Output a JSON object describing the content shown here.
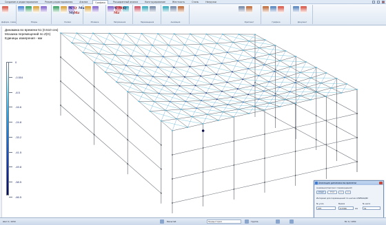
{
  "titlebar": {
    "tabs": [
      "Создание и редактирование",
      "Режим редактирования",
      "Анализ",
      "Графика",
      "Расширенный анализ",
      "Конструирование",
      "Жесткость",
      "Сталь",
      "Нагрузки"
    ],
    "active_tab": 3
  },
  "ribbon": {
    "groups": [
      {
        "label": "Деформ. схема"
      },
      {
        "label": "Эпюры"
      },
      {
        "label": "Усилия"
      },
      {
        "label": "Мозаика"
      },
      {
        "label": "Напряжения"
      },
      {
        "label": "Перемещения"
      },
      {
        "label": "Анимация"
      },
      {
        "label": "Фрагмент"
      },
      {
        "label": "Графика"
      },
      {
        "label": "Документ"
      }
    ],
    "icons": {
      "group1": [
        "N",
        "M",
        "Q",
        "Σ"
      ],
      "group2": [
        "N",
        "Q",
        "Mx",
        "My",
        "Mz"
      ],
      "group3": [
        "N",
        "My",
        "Q",
        "Mz"
      ]
    }
  },
  "info": {
    "line1": "Динамика во времени 51 (0.510 сек)",
    "line2": "Мозаика перемещений по Z(G)",
    "line3": "Единицы измерения - мм"
  },
  "legend": {
    "ticks": [
      "0",
      "-0.504",
      "-8.5",
      "-16.6",
      "-24.8",
      "-33.2",
      "-41.5",
      "-49.8",
      "-58.5",
      "-66.5"
    ]
  },
  "dialog": {
    "title": "Анимация динамики во времени",
    "animation_label": "Анимация(прогресс перемещений)",
    "start_label": "Старт",
    "stop_label": "Стоп",
    "prev_label": "<<",
    "next_label": ">>",
    "interval_label": "Интервал для перемещений по шагам АНИМАЦИИ",
    "col1_label": "№ узла",
    "col2_label": "Время",
    "col3_label": "№ шага",
    "col1_value": "375",
    "col2_value": "0.5780",
    "col2_unit": "мм",
    "col3_value": "51"
  },
  "statusbar": {
    "left_text": "Шаг 0 / 1050",
    "scale_text": "Масштаб",
    "mode_value": "Предыстория",
    "group_text": "Группа",
    "right_text": "Мс 0 / 1050"
  }
}
